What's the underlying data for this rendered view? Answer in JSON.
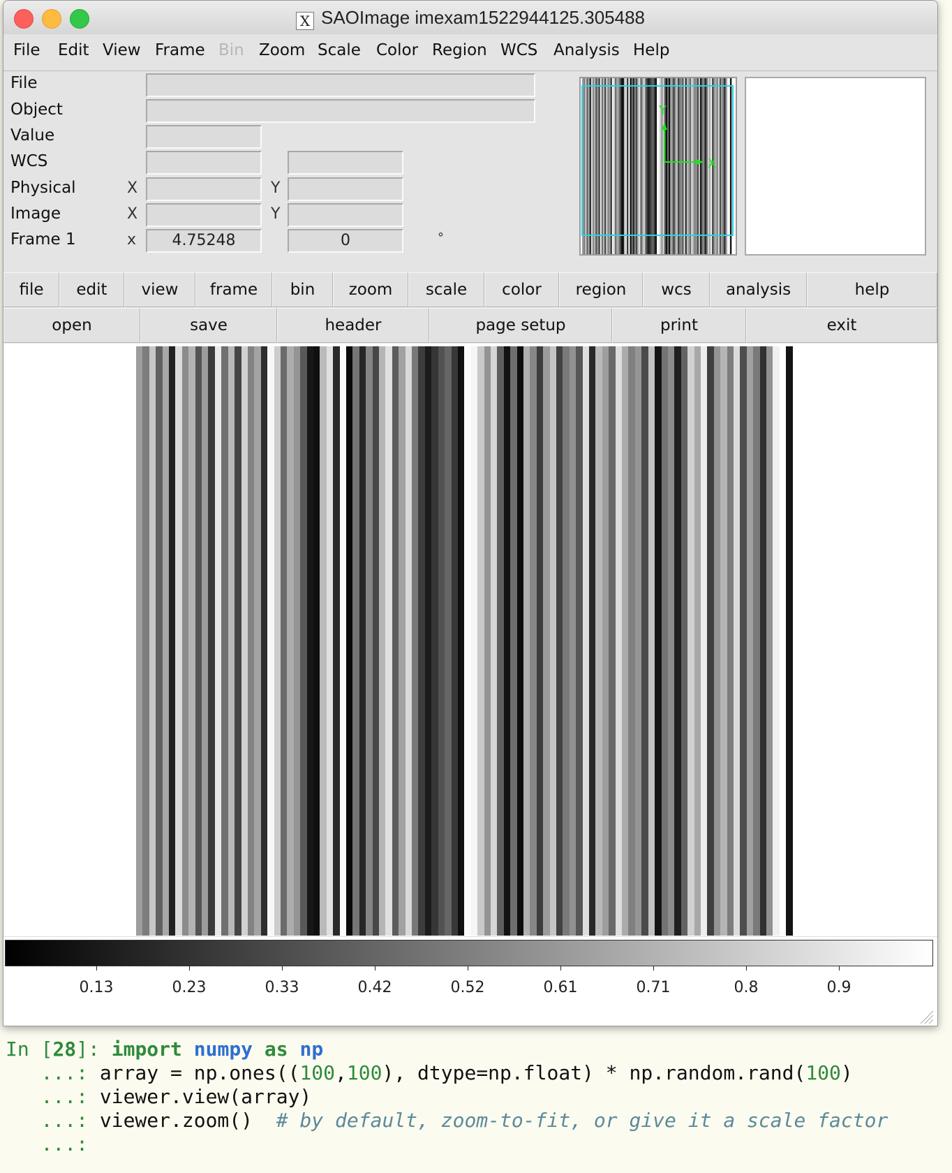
{
  "window": {
    "title": "SAOImage imexam1522944125.305488",
    "x_logo": "X"
  },
  "menubar": [
    {
      "label": "File",
      "enabled": true
    },
    {
      "label": "Edit",
      "enabled": true
    },
    {
      "label": "View",
      "enabled": true
    },
    {
      "label": "Frame",
      "enabled": true
    },
    {
      "label": "Bin",
      "enabled": false
    },
    {
      "label": "Zoom",
      "enabled": true
    },
    {
      "label": "Scale",
      "enabled": true
    },
    {
      "label": "Color",
      "enabled": true
    },
    {
      "label": "Region",
      "enabled": true
    },
    {
      "label": "WCS",
      "enabled": true
    },
    {
      "label": "Analysis",
      "enabled": true
    },
    {
      "label": "Help",
      "enabled": true
    }
  ],
  "info": {
    "labels": {
      "file": "File",
      "object": "Object",
      "value": "Value",
      "wcs": "WCS",
      "physical": "Physical",
      "image": "Image",
      "frame": "Frame 1"
    },
    "axis_x": "X",
    "axis_y": "Y",
    "axis_frame_x": "x",
    "fields": {
      "file": "",
      "object": "",
      "value": "",
      "wcs_1": "",
      "wcs_2": "",
      "physical_x": "",
      "physical_y": "",
      "image_x": "",
      "image_y": "",
      "frame_zoom": "4.75248",
      "frame_angle": "0"
    },
    "degree_symbol": "°",
    "compass": {
      "x": "X",
      "y": "Y"
    }
  },
  "buttonbar": {
    "main": [
      "file",
      "edit",
      "view",
      "frame",
      "bin",
      "zoom",
      "scale",
      "color",
      "region",
      "wcs",
      "analysis",
      "help"
    ],
    "sub": [
      "open",
      "save",
      "header",
      "page setup",
      "print",
      "exit"
    ]
  },
  "image": {
    "stripe_grays": [
      0.62,
      0.49,
      0.78,
      0.38,
      0.66,
      0.13,
      0.86,
      0.55,
      0.7,
      0.33,
      0.61,
      0.23,
      0.91,
      0.44,
      0.72,
      0.27,
      0.82,
      0.51,
      0.64,
      0.18,
      0.97,
      0.8,
      0.42,
      0.68,
      0.58,
      0.35,
      0.09,
      0.06,
      0.73,
      0.88,
      0.16,
      0.99,
      0.04,
      0.46,
      0.15,
      0.52,
      0.28,
      0.71,
      0.88,
      0.36,
      0.63,
      0.85,
      0.47,
      0.24,
      0.11,
      0.21,
      0.32,
      0.4,
      0.22,
      0.06,
      0.98,
      0.96,
      0.79,
      0.58,
      0.84,
      0.37,
      0.07,
      0.43,
      0.05,
      0.69,
      0.53,
      0.24,
      0.61,
      0.77,
      0.26,
      0.48,
      0.57,
      0.34,
      0.87,
      0.16,
      0.73,
      0.62,
      0.41,
      0.87,
      0.67,
      0.5,
      0.59,
      0.29,
      0.76,
      0.08,
      0.45,
      0.55,
      0.12,
      0.39,
      0.82,
      0.66,
      0.93,
      0.25,
      0.58,
      0.71,
      0.49,
      0.86,
      0.3,
      0.63,
      0.48,
      0.19,
      0.57,
      0.94,
      1.0,
      0.08
    ]
  },
  "colorbar": {
    "ticks": [
      "0.13",
      "0.23",
      "0.33",
      "0.42",
      "0.52",
      "0.61",
      "0.71",
      "0.8",
      "0.9"
    ]
  },
  "terminal": {
    "prompt": "In [",
    "prompt_num": "28",
    "prompt_end": "]: ",
    "cont": "   ...: ",
    "line1_kw1": "import",
    "line1_mod": "numpy",
    "line1_kw2": "as",
    "line1_alias": "np",
    "line2_a": "array = np.ones((",
    "line2_n1": "100",
    "line2_c": ",",
    "line2_n2": "100",
    "line2_b": "), dtype=np.float) ",
    "line2_op": "*",
    "line2_d": " np.random.rand(",
    "line2_n3": "100",
    "line2_e": ")",
    "line3": "viewer.view(array)",
    "line4_code": "viewer.zoom()  ",
    "line4_comment": "# by default, zoom-to-fit, or give it a scale factor"
  }
}
